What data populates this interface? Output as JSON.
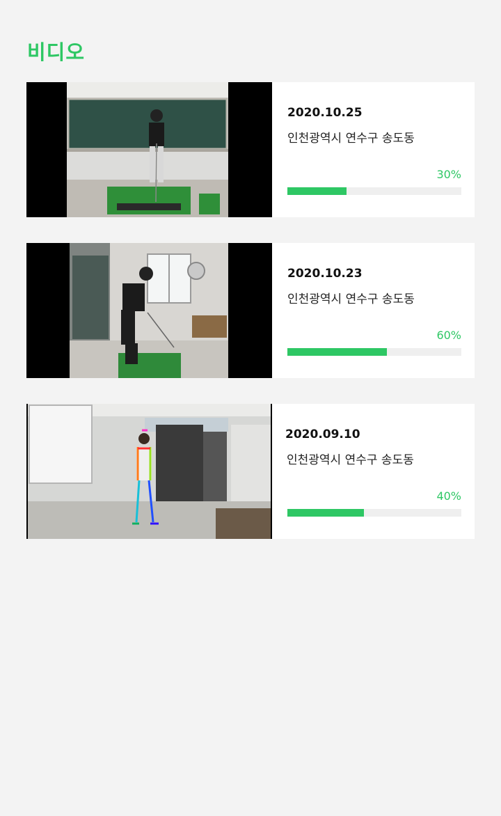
{
  "header": {
    "title": "비디오"
  },
  "videos": [
    {
      "date": "2020.10.25",
      "location": "인천광역시 연수구 송도동",
      "progress_label": "30%",
      "progress": 0.34
    },
    {
      "date": "2020.10.23",
      "location": "인천광역시 연수구 송도동",
      "progress_label": "60%",
      "progress": 0.57
    },
    {
      "date": "2020.09.10",
      "location": "인천광역시 연수구 송도동",
      "progress_label": "40%",
      "progress": 0.44
    }
  ],
  "colors": {
    "accent": "#2ec764",
    "background": "#f3f3f3",
    "card": "#ffffff",
    "track": "#efefef"
  }
}
